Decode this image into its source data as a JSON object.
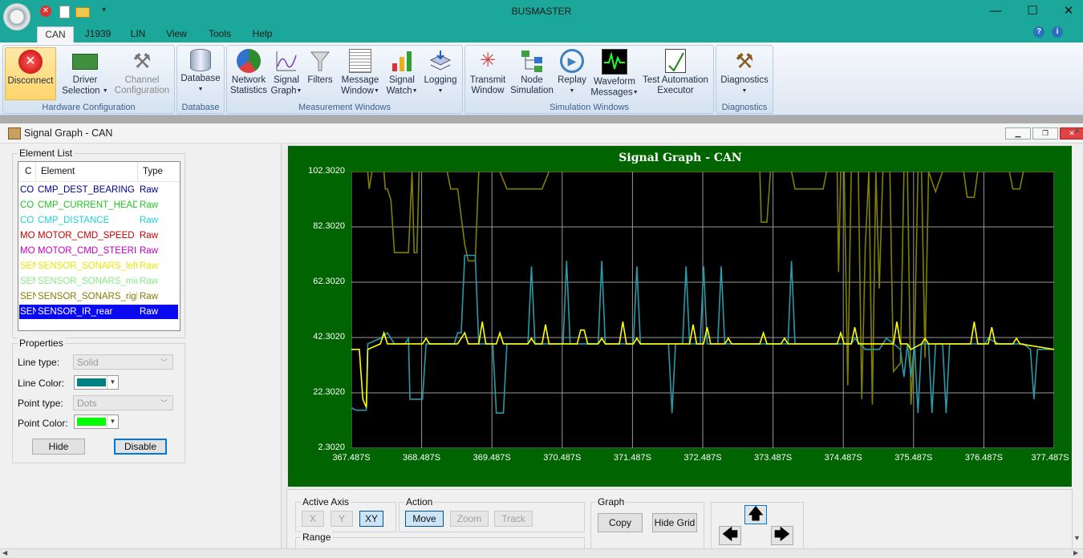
{
  "app": {
    "title": "BUSMASTER"
  },
  "ribbon_tabs": [
    "CAN",
    "J1939",
    "LIN",
    "View",
    "Tools",
    "Help"
  ],
  "ribbon_groups": {
    "hardware": {
      "label": "Hardware Configuration",
      "disconnect": "Disconnect",
      "driver_1": "Driver",
      "driver_2": "Selection",
      "channel_1": "Channel",
      "channel_2": "Configuration"
    },
    "database": {
      "label": "Database",
      "database": "Database"
    },
    "measurement": {
      "label": "Measurement Windows",
      "network_1": "Network",
      "network_2": "Statistics",
      "signal_graph_1": "Signal",
      "signal_graph_2": "Graph",
      "filters": "Filters",
      "message_1": "Message",
      "message_2": "Window",
      "signal_watch_1": "Signal",
      "signal_watch_2": "Watch",
      "logging": "Logging"
    },
    "simulation": {
      "label": "Simulation Windows",
      "transmit_1": "Transmit",
      "transmit_2": "Window",
      "node_1": "Node",
      "node_2": "Simulation",
      "replay": "Replay",
      "waveform_1": "Waveform",
      "waveform_2": "Messages",
      "test_1": "Test Automation",
      "test_2": "Executor"
    },
    "diagnostics": {
      "label": "Diagnostics",
      "diagnostics": "Diagnostics"
    }
  },
  "child_window": {
    "title": "Signal Graph - CAN"
  },
  "element_list": {
    "legend": "Element List",
    "columns": [
      "C",
      "Element",
      "Type"
    ],
    "rows": [
      {
        "c": "CO",
        "element": "CMP_DEST_BEARING",
        "type": "Raw",
        "color": "#00008b"
      },
      {
        "c": "CO",
        "element": "CMP_CURRENT_HEADIN",
        "type": "Raw",
        "color": "#22c422"
      },
      {
        "c": "CO",
        "element": "CMP_DISTANCE",
        "type": "Raw",
        "color": "#22d0d8"
      },
      {
        "c": "MO",
        "element": "MOTOR_CMD_SPEED",
        "type": "Raw",
        "color": "#c00000"
      },
      {
        "c": "MO",
        "element": "MOTOR_CMD_STEERIN",
        "type": "Raw",
        "color": "#c000c0"
      },
      {
        "c": "SEN",
        "element": "SENSOR_SONARS_left",
        "type": "Raw",
        "color": "#e8e800"
      },
      {
        "c": "SEN",
        "element": "SENSOR_SONARS_mid",
        "type": "Raw",
        "color": "#88e888"
      },
      {
        "c": "SEN",
        "element": "SENSOR_SONARS_right",
        "type": "Raw",
        "color": "#808000"
      },
      {
        "c": "SEN",
        "element": "SENSOR_IR_rear",
        "type": "Raw",
        "color": "#ffffff"
      }
    ]
  },
  "properties": {
    "legend": "Properties",
    "line_type_label": "Line type:",
    "line_type_value": "Solid",
    "line_color_label": "Line Color:",
    "line_color": "#008080",
    "point_type_label": "Point type:",
    "point_type_value": "Dots",
    "point_color_label": "Point Color:",
    "point_color": "#00ff00",
    "hide_button": "Hide",
    "disable_button": "Disable"
  },
  "chart_data": {
    "type": "line",
    "title": "Signal Graph - CAN",
    "xlabel": "",
    "ylabel": "",
    "xlim": [
      367.487,
      377.487
    ],
    "ylim": [
      2.302,
      102.302
    ],
    "y_ticks": [
      "102.3020",
      "82.3020",
      "62.3020",
      "42.3020",
      "22.3020",
      "2.3020"
    ],
    "x_ticks": [
      "367.487S",
      "368.487S",
      "369.487S",
      "370.487S",
      "371.487S",
      "372.487S",
      "373.487S",
      "374.487S",
      "375.487S",
      "376.487S",
      "377.487S"
    ],
    "grid": true,
    "background": "#000000",
    "series": [
      {
        "color": "#808000",
        "points": [
          [
            367.487,
            102.3
          ],
          [
            367.72,
            102.3
          ],
          [
            367.74,
            96
          ],
          [
            367.78,
            102.3
          ],
          [
            367.95,
            102.3
          ],
          [
            367.97,
            96
          ],
          [
            368.0,
            96
          ],
          [
            368.05,
            92
          ],
          [
            368.1,
            73
          ],
          [
            368.3,
            73
          ],
          [
            368.35,
            102.3
          ],
          [
            368.38,
            73
          ],
          [
            368.42,
            73
          ],
          [
            368.45,
            102.3
          ],
          [
            368.85,
            102.3
          ],
          [
            368.9,
            96
          ],
          [
            369.0,
            96
          ],
          [
            369.1,
            76
          ],
          [
            369.15,
            70
          ],
          [
            369.25,
            70
          ],
          [
            369.3,
            102.3
          ],
          [
            369.6,
            102.3
          ],
          [
            369.7,
            96
          ],
          [
            370.2,
            96
          ],
          [
            370.3,
            102.3
          ],
          [
            373.3,
            102.3
          ],
          [
            373.32,
            84
          ],
          [
            373.4,
            84
          ],
          [
            373.45,
            102.3
          ],
          [
            373.75,
            102.3
          ],
          [
            373.8,
            96
          ],
          [
            374.2,
            96
          ],
          [
            374.25,
            102.3
          ],
          [
            374.4,
            102.3
          ],
          [
            374.42,
            66
          ],
          [
            374.45,
            102.3
          ],
          [
            374.5,
            102.3
          ],
          [
            374.55,
            25
          ],
          [
            374.6,
            102.3
          ],
          [
            374.7,
            102.3
          ],
          [
            374.75,
            20
          ],
          [
            374.8,
            75
          ],
          [
            374.85,
            102.3
          ],
          [
            374.9,
            18
          ],
          [
            374.95,
            102.3
          ],
          [
            375.0,
            60
          ],
          [
            375.05,
            102.3
          ],
          [
            375.15,
            102.3
          ],
          [
            375.2,
            30
          ],
          [
            375.3,
            33
          ],
          [
            375.35,
            102.3
          ],
          [
            375.4,
            102.3
          ],
          [
            375.45,
            18
          ],
          [
            375.5,
            40
          ],
          [
            375.55,
            102.3
          ],
          [
            375.6,
            102.3
          ],
          [
            375.65,
            35
          ],
          [
            375.7,
            102.3
          ],
          [
            375.8,
            95
          ],
          [
            375.9,
            102.3
          ],
          [
            376.2,
            102.3
          ],
          [
            376.25,
            93
          ],
          [
            376.35,
            93
          ],
          [
            376.4,
            102.3
          ],
          [
            376.85,
            102.3
          ],
          [
            376.9,
            96
          ],
          [
            377.0,
            96
          ],
          [
            377.05,
            102.3
          ],
          [
            377.487,
            102.3
          ]
        ]
      },
      {
        "color": "#2a9aa8",
        "points": [
          [
            367.487,
            17
          ],
          [
            367.55,
            16
          ],
          [
            367.7,
            16
          ],
          [
            367.72,
            40
          ],
          [
            367.9,
            42
          ],
          [
            368.0,
            44
          ],
          [
            368.1,
            40
          ],
          [
            368.25,
            40
          ],
          [
            368.3,
            42
          ],
          [
            368.32,
            20
          ],
          [
            368.5,
            20
          ],
          [
            368.55,
            40
          ],
          [
            368.95,
            40
          ],
          [
            369.0,
            44
          ],
          [
            369.05,
            44
          ],
          [
            369.1,
            72
          ],
          [
            369.25,
            72
          ],
          [
            369.3,
            40
          ],
          [
            369.5,
            40
          ],
          [
            369.55,
            15
          ],
          [
            369.65,
            15
          ],
          [
            369.7,
            40
          ],
          [
            370.0,
            40
          ],
          [
            370.05,
            68
          ],
          [
            370.1,
            40
          ],
          [
            370.5,
            40
          ],
          [
            370.55,
            70
          ],
          [
            370.6,
            40
          ],
          [
            371.0,
            40
          ],
          [
            371.05,
            70
          ],
          [
            371.1,
            40
          ],
          [
            371.5,
            40
          ],
          [
            371.55,
            68
          ],
          [
            371.6,
            40
          ],
          [
            372.0,
            40
          ],
          [
            372.05,
            15
          ],
          [
            372.1,
            40
          ],
          [
            372.2,
            40
          ],
          [
            372.25,
            68
          ],
          [
            372.3,
            40
          ],
          [
            372.45,
            40
          ],
          [
            372.5,
            68
          ],
          [
            372.55,
            40
          ],
          [
            372.7,
            40
          ],
          [
            372.75,
            68
          ],
          [
            372.8,
            40
          ],
          [
            373.1,
            40
          ],
          [
            373.15,
            40
          ],
          [
            373.5,
            40
          ],
          [
            373.55,
            40
          ],
          [
            373.7,
            40
          ],
          [
            373.75,
            70
          ],
          [
            373.8,
            40
          ],
          [
            374.6,
            40
          ],
          [
            374.65,
            42
          ],
          [
            374.8,
            38
          ],
          [
            375.0,
            38
          ],
          [
            375.1,
            42
          ],
          [
            375.2,
            40
          ],
          [
            375.3,
            38
          ],
          [
            375.35,
            28
          ],
          [
            375.4,
            40
          ],
          [
            375.45,
            28
          ],
          [
            375.5,
            40
          ],
          [
            375.55,
            15
          ],
          [
            375.6,
            40
          ],
          [
            375.7,
            40
          ],
          [
            375.75,
            15
          ],
          [
            375.8,
            40
          ],
          [
            375.9,
            40
          ],
          [
            375.95,
            15
          ],
          [
            376.0,
            40
          ],
          [
            376.5,
            40
          ],
          [
            376.55,
            42
          ],
          [
            376.7,
            40
          ],
          [
            377.0,
            40
          ],
          [
            377.05,
            40
          ],
          [
            377.15,
            38
          ],
          [
            377.2,
            20
          ],
          [
            377.25,
            38
          ],
          [
            377.487,
            38
          ]
        ]
      },
      {
        "color": "#ffff00",
        "points": [
          [
            367.487,
            38
          ],
          [
            367.6,
            38
          ],
          [
            367.65,
            20
          ],
          [
            367.7,
            17
          ],
          [
            367.72,
            38
          ],
          [
            367.9,
            40
          ],
          [
            367.95,
            44
          ],
          [
            368.0,
            40
          ],
          [
            368.5,
            40
          ],
          [
            368.55,
            42
          ],
          [
            368.6,
            40
          ],
          [
            369.0,
            40
          ],
          [
            369.05,
            42
          ],
          [
            369.1,
            44
          ],
          [
            369.15,
            40
          ],
          [
            369.3,
            40
          ],
          [
            369.35,
            48
          ],
          [
            369.4,
            40
          ],
          [
            369.55,
            40
          ],
          [
            369.6,
            44
          ],
          [
            369.65,
            40
          ],
          [
            370.0,
            40
          ],
          [
            370.05,
            42
          ],
          [
            370.1,
            40
          ],
          [
            370.2,
            40
          ],
          [
            370.25,
            47
          ],
          [
            370.3,
            40
          ],
          [
            370.7,
            40
          ],
          [
            370.75,
            45
          ],
          [
            370.8,
            45
          ],
          [
            370.85,
            40
          ],
          [
            371.0,
            40
          ],
          [
            371.05,
            42
          ],
          [
            371.1,
            40
          ],
          [
            371.3,
            40
          ],
          [
            371.35,
            48
          ],
          [
            371.4,
            40
          ],
          [
            371.5,
            40
          ],
          [
            371.55,
            42
          ],
          [
            371.6,
            40
          ],
          [
            372.3,
            40
          ],
          [
            372.35,
            47
          ],
          [
            372.4,
            40
          ],
          [
            372.5,
            40
          ],
          [
            372.55,
            46
          ],
          [
            372.6,
            40
          ],
          [
            372.8,
            40
          ],
          [
            372.85,
            42
          ],
          [
            372.9,
            40
          ],
          [
            373.0,
            40
          ],
          [
            373.05,
            40
          ],
          [
            373.3,
            40
          ],
          [
            373.35,
            44
          ],
          [
            373.4,
            40
          ],
          [
            373.6,
            40
          ],
          [
            373.65,
            42
          ],
          [
            373.7,
            40
          ],
          [
            374.0,
            40
          ],
          [
            374.05,
            40
          ],
          [
            374.4,
            40
          ],
          [
            374.45,
            44
          ],
          [
            374.5,
            40
          ],
          [
            374.6,
            40
          ],
          [
            374.65,
            46
          ],
          [
            374.7,
            40
          ],
          [
            374.8,
            40
          ],
          [
            374.85,
            40
          ],
          [
            375.2,
            40
          ],
          [
            375.25,
            48
          ],
          [
            375.3,
            40
          ],
          [
            375.4,
            40
          ],
          [
            375.45,
            38
          ],
          [
            375.6,
            40
          ],
          [
            375.65,
            42
          ],
          [
            375.7,
            40
          ],
          [
            376.0,
            40
          ],
          [
            376.05,
            40
          ],
          [
            376.3,
            40
          ],
          [
            376.35,
            48
          ],
          [
            376.4,
            40
          ],
          [
            376.55,
            40
          ],
          [
            376.6,
            46
          ],
          [
            376.65,
            40
          ],
          [
            376.9,
            40
          ],
          [
            376.95,
            42
          ],
          [
            377.0,
            40
          ],
          [
            377.487,
            38
          ]
        ]
      }
    ]
  },
  "bottom": {
    "active_axis_label": "Active Axis",
    "axis_x": "X",
    "axis_y": "Y",
    "axis_xy": "XY",
    "action_label": "Action",
    "move": "Move",
    "zoom": "Zoom",
    "track": "Track",
    "graph_label": "Graph",
    "copy": "Copy",
    "hide_grid": "Hide Grid",
    "range_label": "Range"
  }
}
